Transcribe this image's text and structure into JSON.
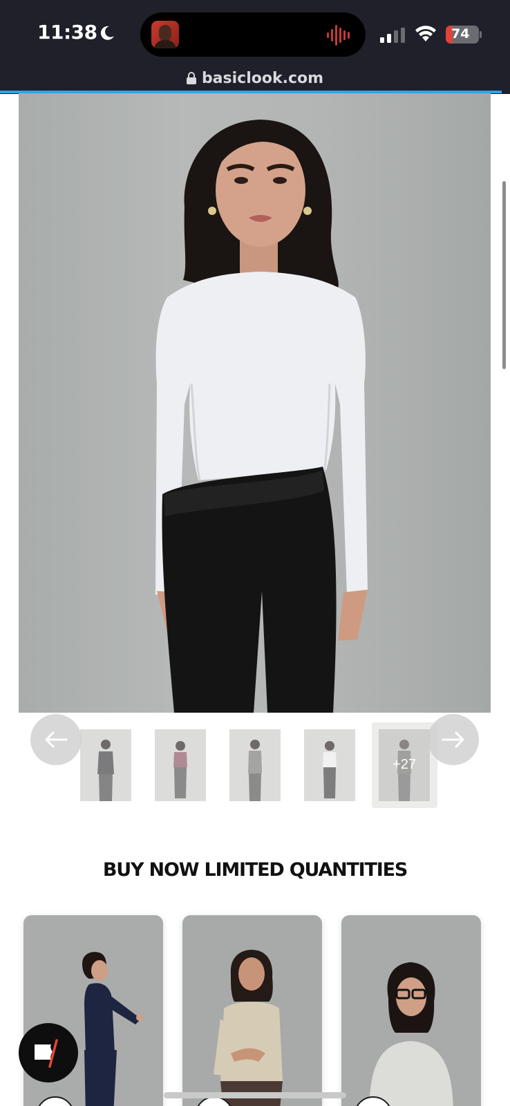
{
  "status_bar": {
    "time": "11:38",
    "battery_level": "74",
    "icons": [
      "moon-icon",
      "signal-icon",
      "wifi-icon",
      "battery-icon"
    ]
  },
  "browser": {
    "url": "basiclook.com",
    "lock_icon": "lock-icon",
    "accent_color": "#2fa3e6"
  },
  "gallery": {
    "thumbnail_count_visible": 5,
    "more_label": "+27",
    "prev_icon": "arrow-left-icon",
    "next_icon": "arrow-right-icon"
  },
  "section": {
    "title": "BUY NOW LIMITED QUANTITIES"
  },
  "products": {
    "cards": [
      {
        "top_color": "#1e2540"
      },
      {
        "top_color": "#d6ccb5"
      },
      {
        "top_color": "#dcdcd8"
      }
    ]
  },
  "chat": {
    "icon": "chat-icon"
  }
}
